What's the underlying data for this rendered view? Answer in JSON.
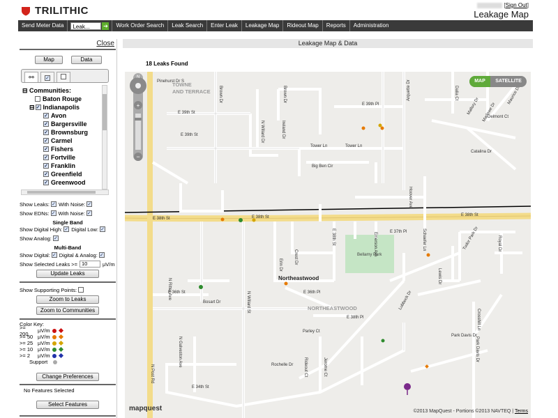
{
  "header": {
    "brand": "TRILITHIC",
    "sign_out": "Sign Out",
    "page_title": "Leakage Map"
  },
  "nav": {
    "send_meter": "Send Meter Data",
    "leak_select": "Leak...",
    "go": "➔",
    "items": [
      "Work Order Search",
      "Leak Search",
      "Enter Leak",
      "Leakage Map",
      "Rideout Map",
      "Reports",
      "Administration"
    ]
  },
  "sidebar": {
    "close": "Close",
    "map_btn": "Map",
    "data_btn": "Data",
    "communities_label": "Communities:",
    "communities": [
      "Baton Rouge",
      "Indianapolis",
      "Avon",
      "Bargersville",
      "Brownsburg",
      "Carmel",
      "Fishers",
      "Fortville",
      "Franklin",
      "Greenfield",
      "Greenwood"
    ],
    "show_leaks": "Show Leaks:",
    "with_noise": "With Noise:",
    "show_edns": "Show EDNs:",
    "single_band": "Single Band",
    "show_digital_high": "Show Digital High:",
    "digital_low": "Digital Low:",
    "show_analog": "Show Analog:",
    "multi_band": "Multi-Band",
    "show_digital": "Show Digital:",
    "digital_analog": "Digital & Analog:",
    "show_selected": "Show Selected Leaks >=",
    "selected_value": "10",
    "selected_unit": "µV/m",
    "update_leaks": "Update Leaks",
    "show_supporting": "Show Supporting Points:",
    "zoom_leaks": "Zoom to Leaks",
    "zoom_communities": "Zoom to Communities",
    "color_key": "Color Key:",
    "key_rows": [
      {
        "label": ">= 200",
        "unit": "µV/m",
        "color": "#cc1111"
      },
      {
        "label": ">= 50",
        "unit": "µV/m",
        "color": "#e67a00"
      },
      {
        "label": ">= 25",
        "unit": "µV/m",
        "color": "#d4a500"
      },
      {
        "label": ">= 10",
        "unit": "µV/m",
        "color": "#2e8b2e"
      },
      {
        "label": ">= 2",
        "unit": "µV/m",
        "color": "#2233aa"
      }
    ],
    "support_label": "Support",
    "change_prefs": "Change Preferences",
    "no_features": "No Features Selected",
    "select_features": "Select Features"
  },
  "main": {
    "title": "Leakage Map & Data",
    "leaks_found": "18 Leaks Found"
  },
  "map": {
    "type_map": "MAP",
    "type_satellite": "SATELLITE",
    "logo": "mapquest",
    "copyright": "©2013 MapQuest - Portions ©2013 NAVTEQ |",
    "terms": "Terms",
    "compass": "N",
    "area_labels": [
      "TOWNE",
      "AND TERRACE",
      "NORTHEASTWOOD",
      "Northeastwood",
      "Bellamy Park"
    ],
    "street_labels": [
      "Pinehurst Dr S",
      "E 39th Pl",
      "E 39th St",
      "Tower Ln",
      "Big Ben Cir",
      "E 38th St",
      "E 37th Pl",
      "E 36th St",
      "Park Davis Dr",
      "Rochelle Dr",
      "E 34th St",
      "Parley Ct",
      "Brown St",
      "E 40th St",
      "E 38th Pl",
      "E 36th Pl",
      "Bosart Dr",
      "E 39th St",
      "Tower Ln",
      "Delmont Ct",
      "Catalina Dr"
    ],
    "vertical_labels": [
      "Brown Dr",
      "Arquette Dr",
      "Marlowe Dr",
      "Dalia Ct",
      "N Willard Dr",
      "Ireland Dr",
      "Emerson Ave",
      "Schaefer Ln",
      "N Post Rd",
      "N Galveston Ave",
      "N Willard St",
      "Hoover Ave",
      "Lubbock Dr",
      "Crosshill Ln",
      "Ruckle Dr",
      "Park Davis Dr",
      "Royal Dr",
      "Tudor Park Dr",
      "Hardin Dr",
      "N Ritter Ave",
      "Erin Dr",
      "Laurel Ct",
      "Crest Dr",
      "Lewis Dr",
      "Jerome Ct",
      "Rideout Ct",
      "E 38th St",
      "Boyd Dr",
      "N 38th St",
      "Shelbourn Ct",
      "E Strathmont Ct",
      "Maurice Dr",
      "Mallory Dr"
    ]
  }
}
